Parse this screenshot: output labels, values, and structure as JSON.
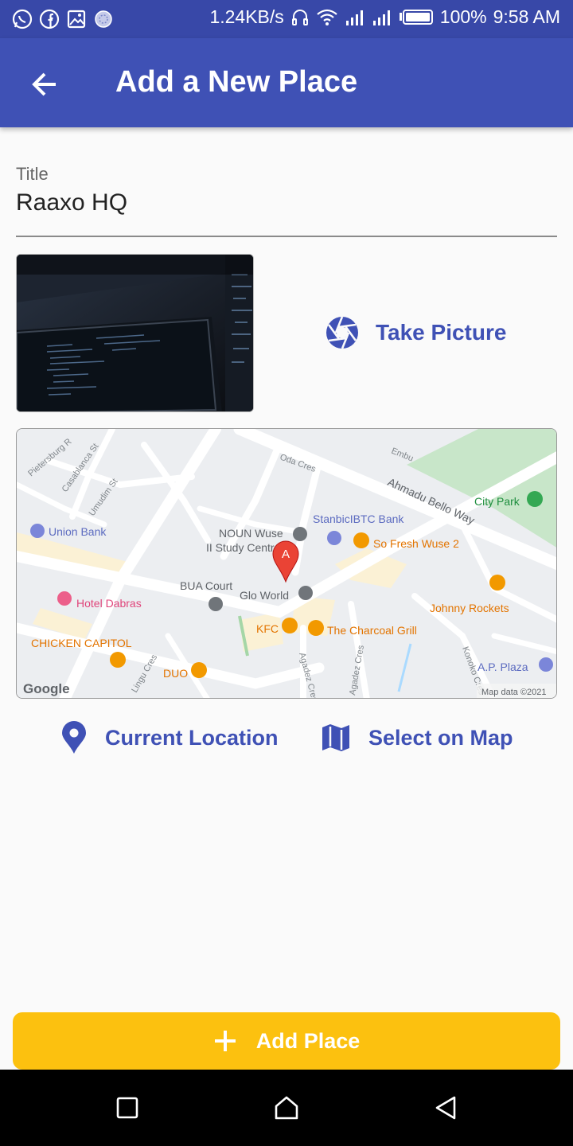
{
  "status_bar": {
    "network_speed": "1.24KB/s",
    "battery": "100%",
    "time": "9:58 AM",
    "left_icons": [
      "whatsapp-icon",
      "facebook-icon",
      "gallery-icon",
      "app-icon"
    ],
    "right_icons": [
      "headset-icon",
      "wifi-icon",
      "signal-icon",
      "signal-icon",
      "battery-icon"
    ]
  },
  "app_bar": {
    "title": "Add a New Place",
    "back_icon": "arrow-back-icon"
  },
  "form": {
    "title_label": "Title",
    "title_value": "Raaxo HQ"
  },
  "image_section": {
    "take_picture_label": "Take Picture",
    "take_picture_icon": "camera-shutter-icon"
  },
  "map": {
    "labels": {
      "union_bank": "Union Bank",
      "noun_wuse": "NOUN Wuse",
      "ii_study_centre": "II Study Centre",
      "stanbic": "StanbicIBTC Bank",
      "so_fresh": "So Fresh Wuse 2",
      "city_park": "City Park",
      "hotel_dabras": "Hotel Dabras",
      "bua_court": "BUA Court",
      "glo_world": "Glo World",
      "johnny_rockets": "Johnny Rockets",
      "chicken_capitol": "CHICKEN CAPITOL",
      "kfc": "KFC",
      "charcoal_grill": "The Charcoal Grill",
      "duo": "DUO",
      "ap_plaza": "A.P. Plaza",
      "ahmadu_bello_way": "Ahmadu Bello Way",
      "oda_cres": "Oda Cres",
      "embu": "Embu",
      "pietersburg": "Pietersburg R",
      "casablanca": "Casablanca St",
      "umudim": "Umudim St",
      "lingu_cres": "Lingu Cres",
      "agadez_cres_1": "Agadez Cres",
      "agadez_cres_2": "Agadez Cres",
      "konoko_cres": "Konoko Cres",
      "marker_letter": "A",
      "google": "Google",
      "attribution": "Map data ©2021"
    },
    "colors": {
      "background": "#eceef1",
      "road": "#ffffff",
      "park": "#c8e6c9",
      "food_pin": "#f29900",
      "poi_text_food": "#e37400",
      "bank_pin": "#7b86d9",
      "hotel_pin": "#ec5f8a",
      "gray_pin": "#70757a",
      "marker": "#ea4335"
    }
  },
  "location_actions": {
    "current_location_label": "Current Location",
    "select_on_map_label": "Select on Map",
    "current_location_icon": "location-pin-icon",
    "select_on_map_icon": "map-icon"
  },
  "add_button": {
    "label": "Add Place",
    "icon": "plus-icon"
  },
  "theme": {
    "primary": "#3f51b5",
    "accent": "#fcc10f",
    "status_bar": "#3848a8"
  }
}
